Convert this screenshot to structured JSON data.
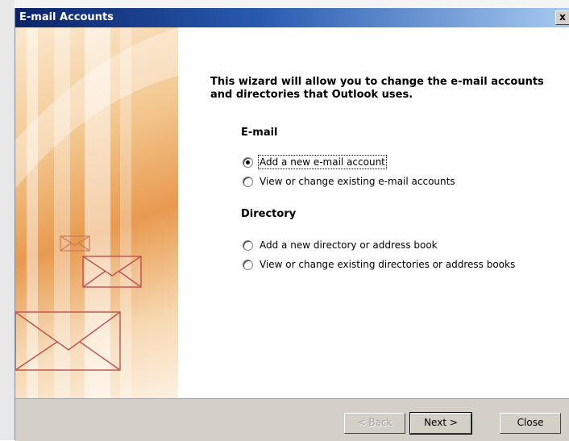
{
  "window": {
    "title": "E-mail Accounts",
    "close_glyph": "x"
  },
  "intro": "This wizard will allow you to change the e-mail accounts and directories that Outlook uses.",
  "email_section": {
    "heading": "E-mail",
    "options": [
      {
        "label": "Add a new e-mail account",
        "checked": true
      },
      {
        "label": "View or change existing e-mail accounts",
        "checked": false
      }
    ]
  },
  "directory_section": {
    "heading": "Directory",
    "options": [
      {
        "label": "Add a new directory or address book",
        "checked": false
      },
      {
        "label": "View or change existing directories or address books",
        "checked": false
      }
    ]
  },
  "buttons": {
    "back": "< Back",
    "next": "Next >",
    "close": "Close"
  },
  "colors": {
    "title_start": "#0a246a",
    "title_end": "#a6caf0",
    "banner": "#e89a4f",
    "envelope": "#c0504d",
    "face": "#d4d0c8"
  }
}
